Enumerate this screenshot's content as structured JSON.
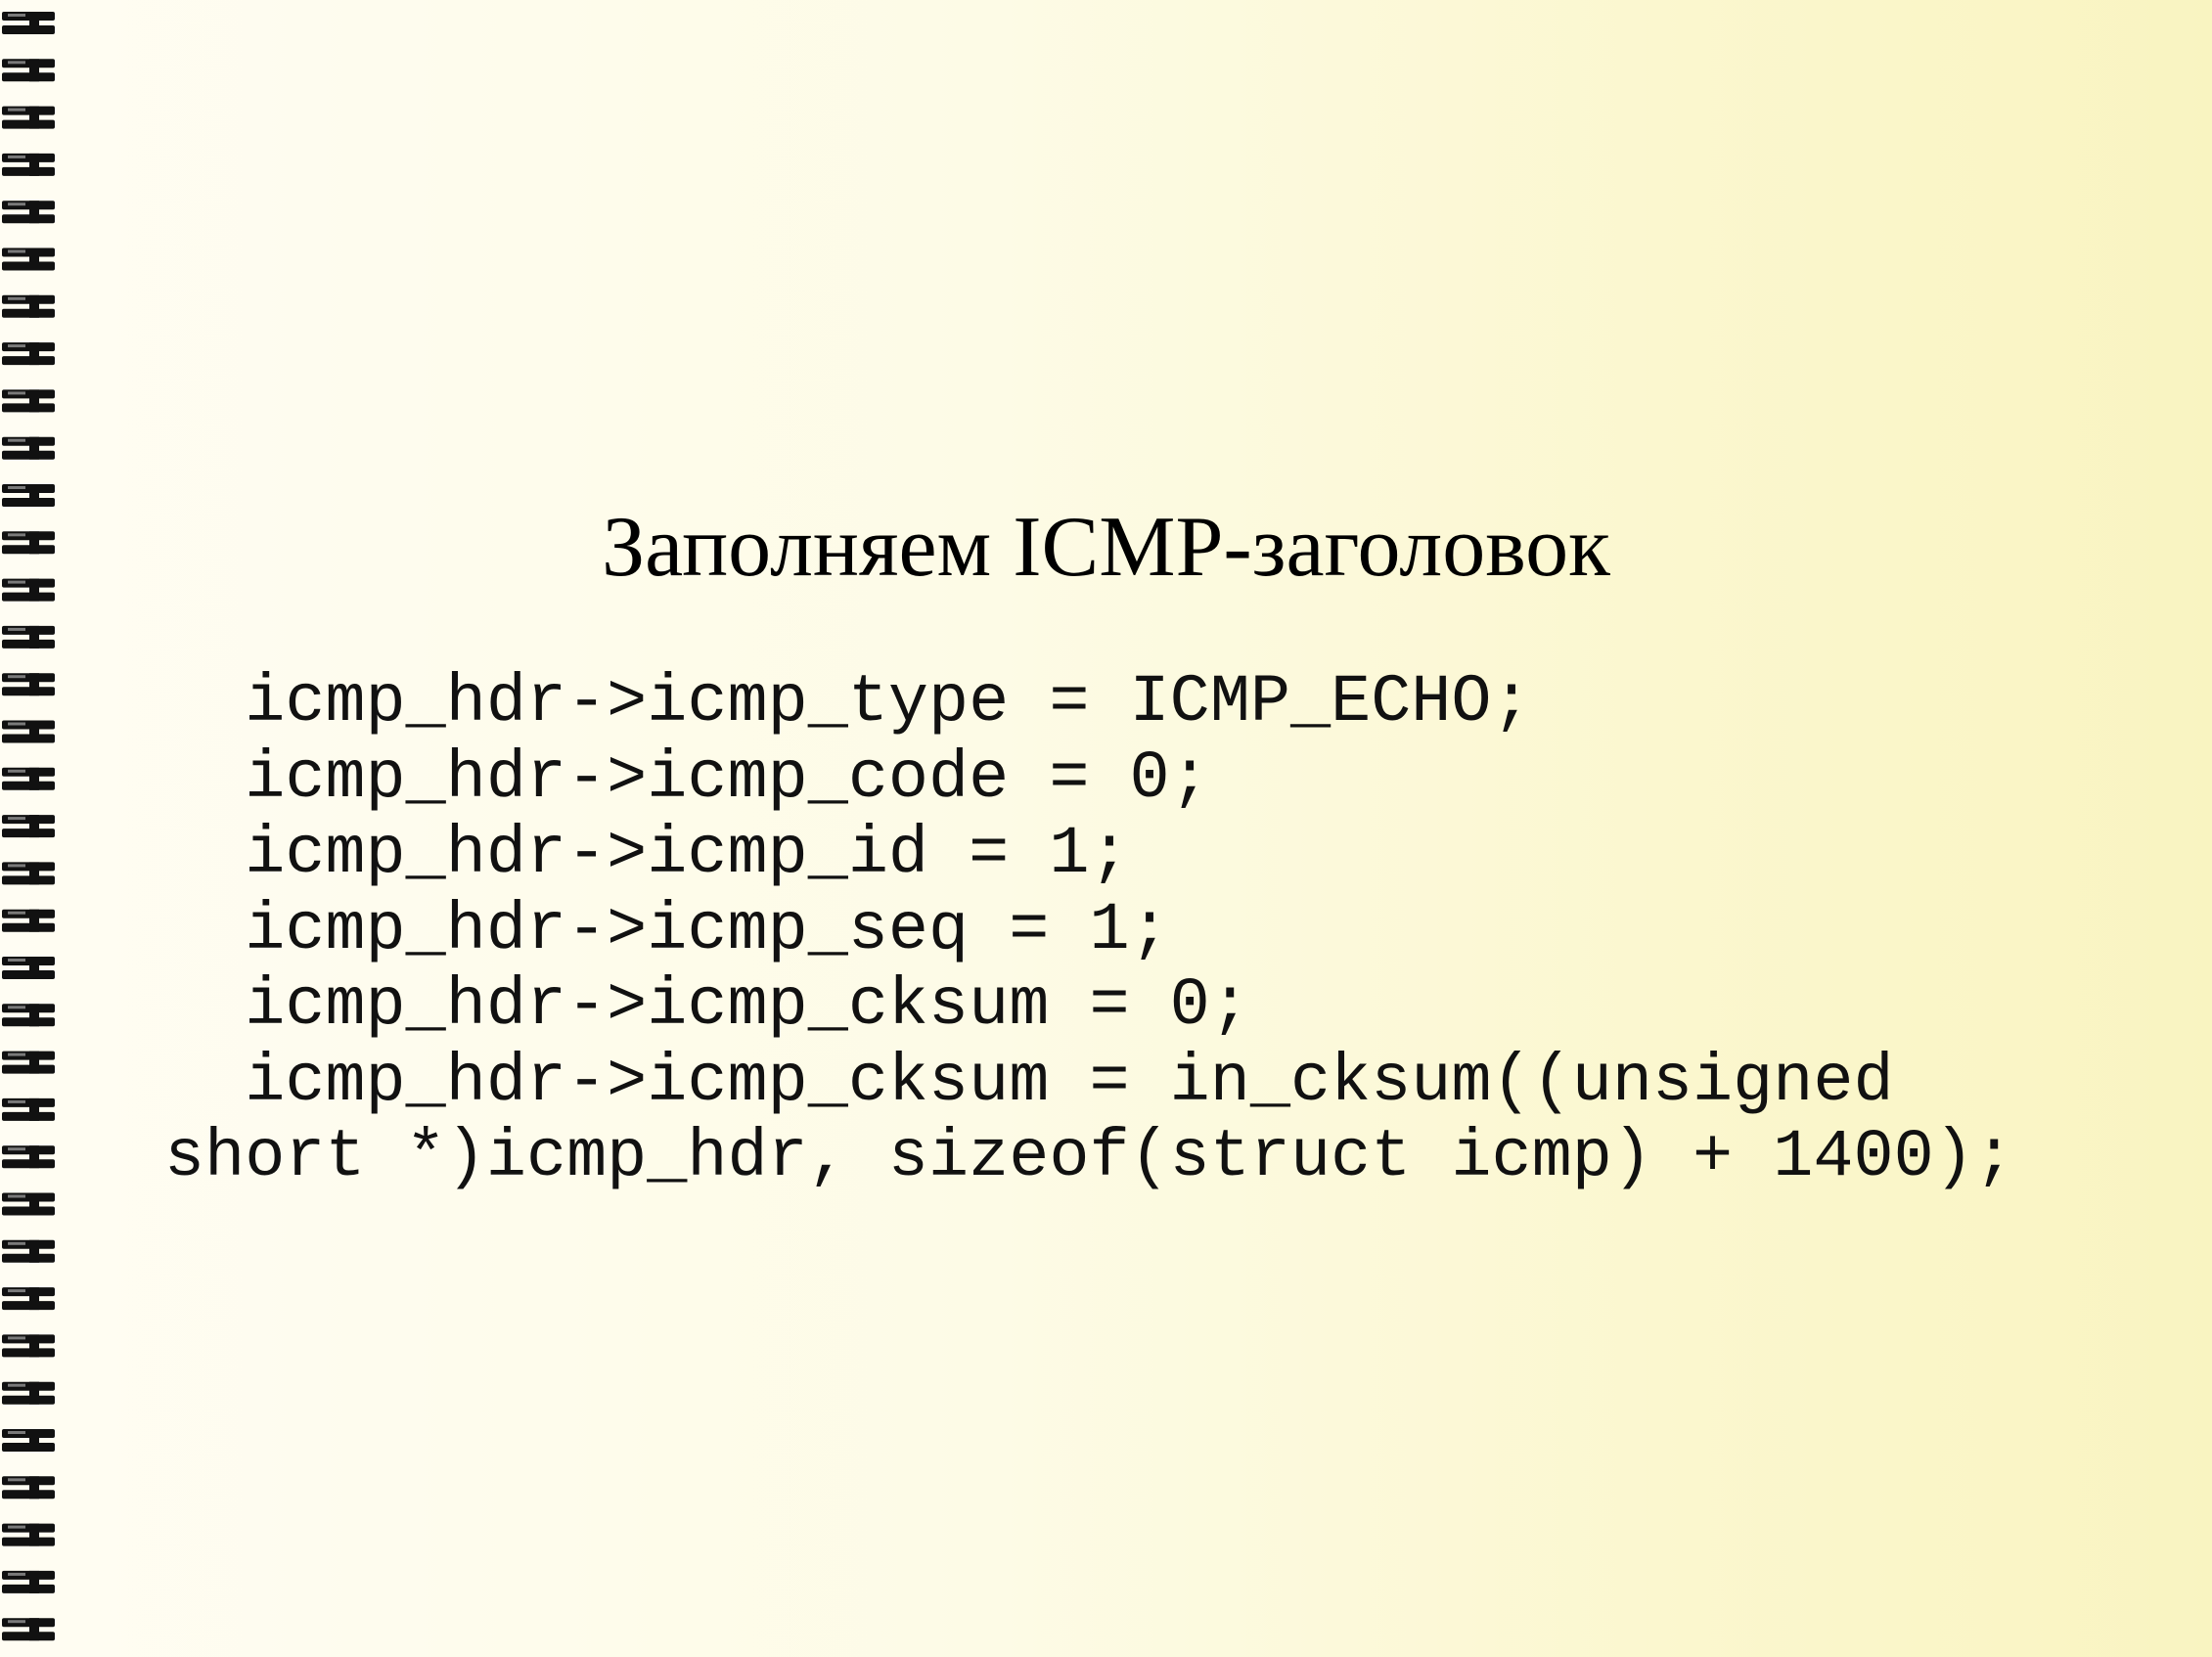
{
  "slide": {
    "title": "Заполняем ICMP-заголовок",
    "code_lines": [
      "  icmp_hdr->icmp_type = ICMP_ECHO;",
      "  icmp_hdr->icmp_code = 0;",
      "  icmp_hdr->icmp_id = 1;",
      "  icmp_hdr->icmp_seq = 1;",
      "  icmp_hdr->icmp_cksum = 0;",
      "  icmp_hdr->icmp_cksum = in_cksum((unsigned",
      "short *)icmp_hdr, sizeof(struct icmp) + 1400);"
    ]
  },
  "decor": {
    "binding": "spiral-binding",
    "binding_color": "#111111",
    "background_colors": [
      "#fffdf3",
      "#f9f4c1"
    ]
  }
}
